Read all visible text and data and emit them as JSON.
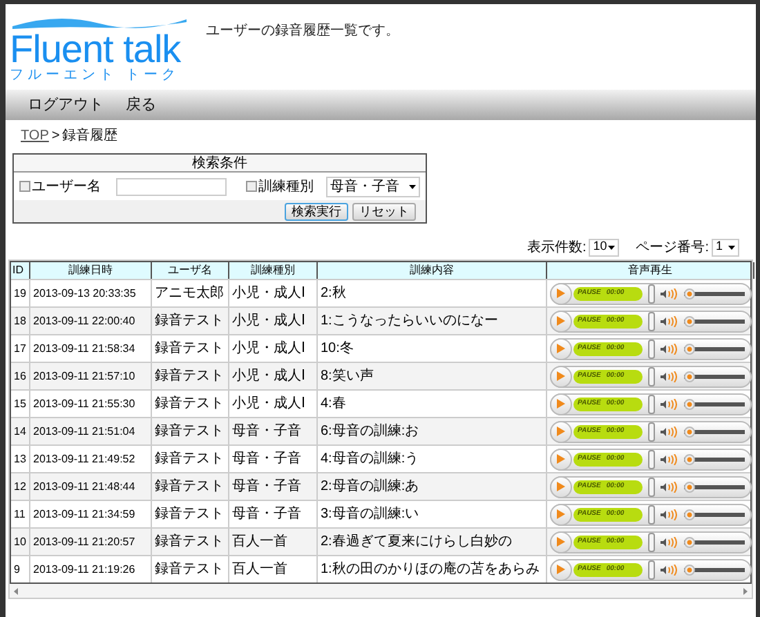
{
  "header": {
    "logo_title": "Fluent talk",
    "logo_subtitle": "フルーエント トーク",
    "tagline": "ユーザーの録音履歴一覧です。"
  },
  "nav": [
    {
      "label": "ログアウト"
    },
    {
      "label": "戻る"
    }
  ],
  "breadcrumb": {
    "link": "TOP",
    "separator": ">",
    "current": "録音履歴"
  },
  "search": {
    "title": "検索条件",
    "user_filter": {
      "label": "ユーザー名",
      "checked": false
    },
    "type_filter": {
      "label": "訓練種別",
      "checked": false
    },
    "type_select": "母音・子音",
    "buttons": [
      "検索実行",
      "リセット"
    ]
  },
  "paging": {
    "per_page_label": "表示件数:",
    "per_page": "10",
    "page_label": "ページ番号:",
    "page": "1"
  },
  "table": {
    "columns": [
      "ID",
      "訓練日時",
      "ユーザ名",
      "訓練種別",
      "訓練内容",
      "音声再生"
    ],
    "rows": [
      {
        "id": "19",
        "datetime": "2013-09-13 20:33:35",
        "user": "アニモ太郎",
        "type": "小児・成人Ⅰ",
        "content": "2:秋",
        "player": {
          "status": "PAUSE",
          "time": "00:00",
          "level": 0
        }
      },
      {
        "id": "18",
        "datetime": "2013-09-11 22:00:40",
        "user": "録音テスト",
        "type": "小児・成人Ⅰ",
        "content": "1:こうなったらいいのになー",
        "player": {
          "status": "PAUSE",
          "time": "00:00",
          "level": 0
        }
      },
      {
        "id": "17",
        "datetime": "2013-09-11 21:58:34",
        "user": "録音テスト",
        "type": "小児・成人Ⅰ",
        "content": "10:冬",
        "player": {
          "status": "PAUSE",
          "time": "00:00",
          "level": 0
        }
      },
      {
        "id": "16",
        "datetime": "2013-09-11 21:57:10",
        "user": "録音テスト",
        "type": "小児・成人Ⅰ",
        "content": "8:笑い声",
        "player": {
          "status": "PAUSE",
          "time": "00:00",
          "level": 0
        }
      },
      {
        "id": "15",
        "datetime": "2013-09-11 21:55:30",
        "user": "録音テスト",
        "type": "小児・成人Ⅰ",
        "content": "4:春",
        "player": {
          "status": "PAUSE",
          "time": "00:00",
          "level": 0
        }
      },
      {
        "id": "14",
        "datetime": "2013-09-11 21:51:04",
        "user": "録音テスト",
        "type": "母音・子音",
        "content": "6:母音の訓練:お",
        "player": {
          "status": "PAUSE",
          "time": "00:00",
          "level": 0
        }
      },
      {
        "id": "13",
        "datetime": "2013-09-11 21:49:52",
        "user": "録音テスト",
        "type": "母音・子音",
        "content": "4:母音の訓練:う",
        "player": {
          "status": "PAUSE",
          "time": "00:00",
          "level": 0
        }
      },
      {
        "id": "12",
        "datetime": "2013-09-11 21:48:44",
        "user": "録音テスト",
        "type": "母音・子音",
        "content": "2:母音の訓練:あ",
        "player": {
          "status": "PAUSE",
          "time": "00:00",
          "level": 0
        }
      },
      {
        "id": "11",
        "datetime": "2013-09-11 21:34:59",
        "user": "録音テスト",
        "type": "母音・子音",
        "content": "3:母音の訓練:い",
        "player": {
          "status": "PAUSE",
          "time": "00:00",
          "level": 0
        }
      },
      {
        "id": "10",
        "datetime": "2013-09-11 21:20:57",
        "user": "録音テスト",
        "type": "百人一首",
        "content": "2:春過ぎて夏来にけらし白妙の",
        "player": {
          "status": "PAUSE",
          "time": "00:00",
          "level": 0
        }
      },
      {
        "id": "9",
        "datetime": "2013-09-11 21:19:26",
        "user": "録音テスト",
        "type": "百人一首",
        "content": "1:秋の田のかりほの庵の苫をあらみ",
        "player": {
          "status": "PAUSE",
          "time": "00:00",
          "level": 0
        }
      }
    ]
  }
}
